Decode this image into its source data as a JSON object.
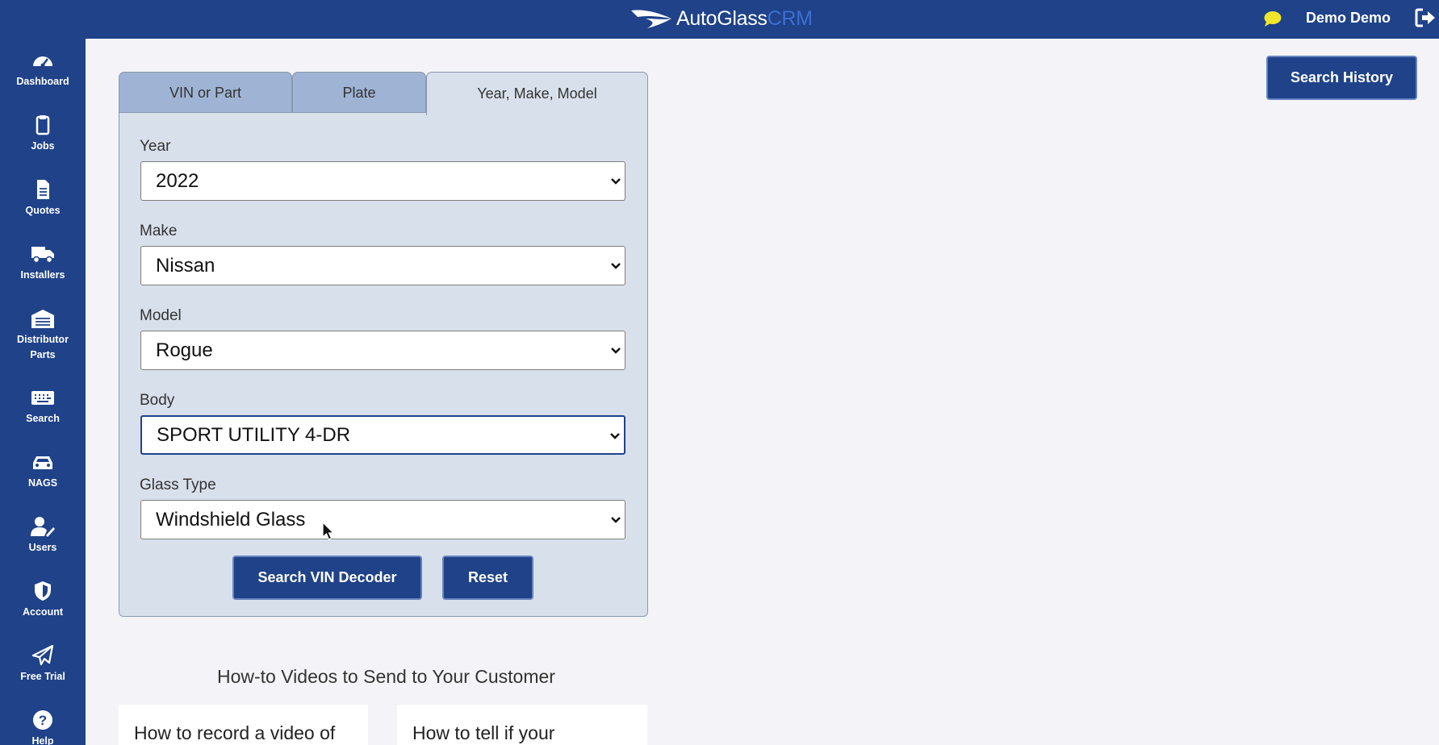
{
  "header": {
    "logo_text": "AutoGlass",
    "logo_suffix": "CRM",
    "user_name": "Demo Demo"
  },
  "sidebar": {
    "items": [
      {
        "label": "Dashboard",
        "icon": "dashboard-gauge-icon"
      },
      {
        "label": "Jobs",
        "icon": "clipboard-icon"
      },
      {
        "label": "Quotes",
        "icon": "document-icon"
      },
      {
        "label": "Installers",
        "icon": "truck-icon"
      },
      {
        "label": "Distributor\nParts",
        "icon": "warehouse-icon"
      },
      {
        "label": "Search",
        "icon": "keyboard-icon"
      },
      {
        "label": "NAGS",
        "icon": "car-icon"
      },
      {
        "label": "Users",
        "icon": "user-edit-icon"
      },
      {
        "label": "Account",
        "icon": "shield-icon"
      },
      {
        "label": "Free Trial",
        "icon": "paper-plane-icon"
      },
      {
        "label": "Help",
        "icon": "question-circle-icon"
      }
    ]
  },
  "search_history_label": "Search History",
  "tabs": [
    {
      "label": "VIN or Part",
      "active": false
    },
    {
      "label": "Plate",
      "active": false
    },
    {
      "label": "Year, Make, Model",
      "active": true
    }
  ],
  "form": {
    "year": {
      "label": "Year",
      "value": "2022"
    },
    "make": {
      "label": "Make",
      "value": "Nissan"
    },
    "model": {
      "label": "Model",
      "value": "Rogue"
    },
    "body": {
      "label": "Body",
      "value": "SPORT UTILITY 4-DR"
    },
    "glass_type": {
      "label": "Glass Type",
      "value": "Windshield Glass"
    },
    "search_button": "Search VIN Decoder",
    "reset_button": "Reset"
  },
  "howto": {
    "title": "How-to Videos to Send to Your Customer",
    "cards": [
      "How to record a video of",
      "How to tell if your"
    ]
  },
  "colors": {
    "brand": "#1f4289",
    "panel": "#d8e0ec",
    "chat": "#f1e62b"
  }
}
